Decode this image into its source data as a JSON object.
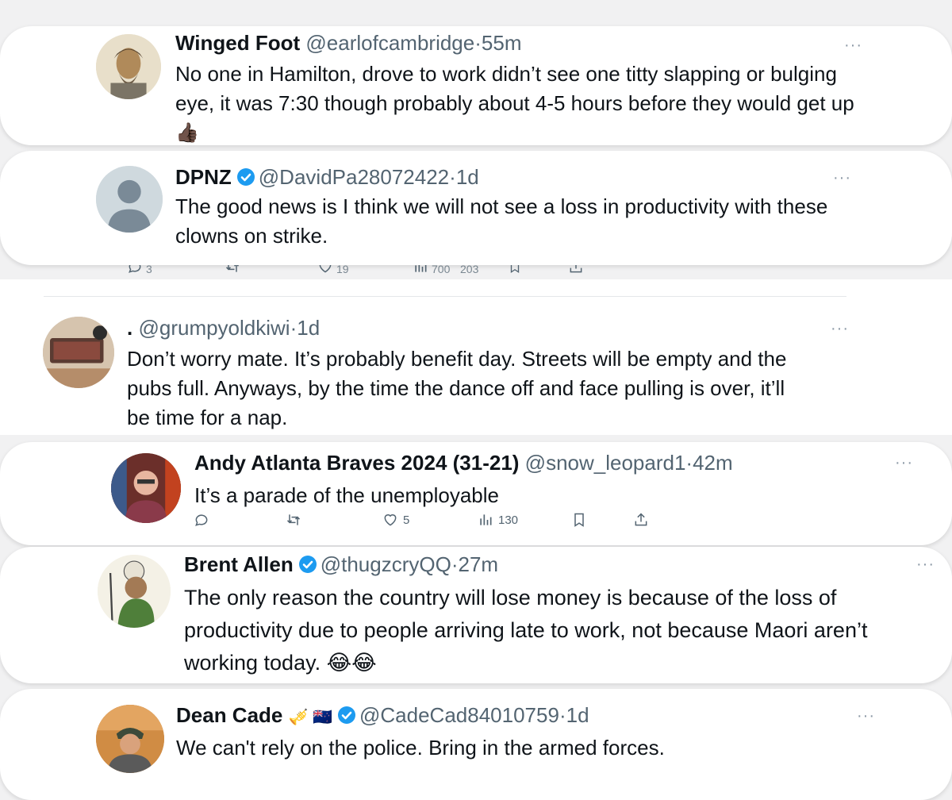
{
  "tweets": [
    {
      "name": "Winged Foot",
      "handle": "@earlofcambridge",
      "dot": "·",
      "time": "55m",
      "lines": [
        "No one in Hamilton, drove to work didn’t see one titty slapping or bulging",
        "eye, it was 7:30 though probably about 4-5 hours before they would get up"
      ],
      "emoji": "👍🏿",
      "more": "···"
    },
    {
      "name": "DPNZ",
      "handle": "@DavidPa28072422",
      "dot": "·",
      "time": "1d",
      "lines": [
        "The good news is I think we will not see a loss in productivity with these",
        "clowns on strike."
      ],
      "more": "···",
      "ghost_actions": [
        "3",
        "19",
        "700",
        "203"
      ]
    },
    {
      "name": ".",
      "handle": "@grumpyoldkiwi",
      "dot": "·",
      "time": "1d",
      "lines": [
        "Don’t worry mate. It’s probably benefit day. Streets will be empty and the",
        "pubs full. Anyways, by the time the dance off and face pulling is over, it’ll",
        "be time for a nap."
      ],
      "more": "···"
    },
    {
      "name": "Andy Atlanta Braves 2024 (31-21)",
      "handle": "@snow_leopard1",
      "dot": "·",
      "time": "42m",
      "lines": [
        "It’s a parade of the unemployable"
      ],
      "more": "···",
      "likes": "5",
      "views": "130"
    },
    {
      "name": "Brent Allen",
      "handle": "@thugzcryQQ",
      "dot": "·",
      "time": "27m",
      "lines": [
        "The only reason the country will lose money is because of the loss of",
        "productivity due to people arriving late to work, not because Maori aren’t",
        "working today. 😂😂"
      ],
      "more": "···"
    },
    {
      "name": "Dean Cade",
      "name_emoji": "🎺 🇳🇿",
      "handle": "@CadeCad84010759",
      "dot": "·",
      "time": "1d",
      "lines": [
        "We can't rely on the police. Bring in the armed forces."
      ],
      "more": "···"
    }
  ],
  "colors": {
    "verified": "#1d9bf0",
    "secondary": "#536471",
    "text": "#0f1419"
  }
}
